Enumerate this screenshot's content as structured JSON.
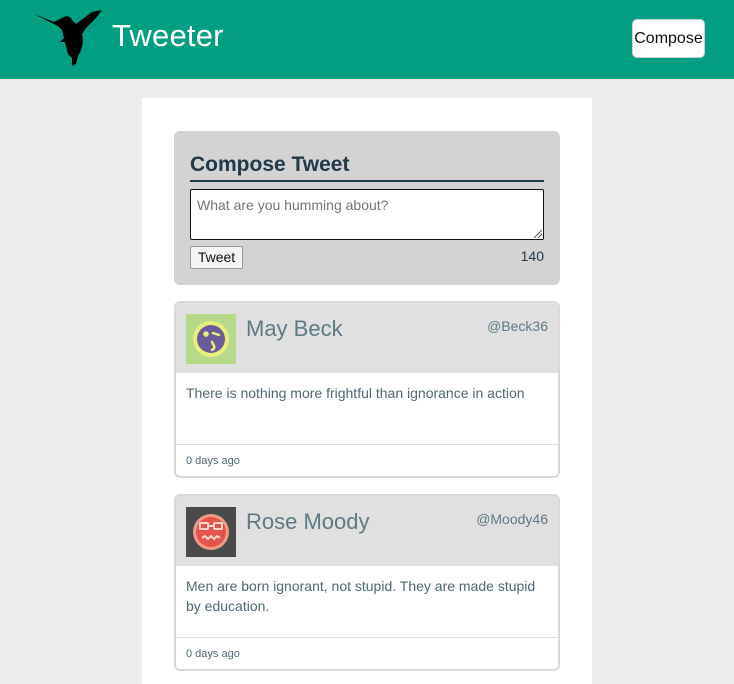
{
  "nav": {
    "brand": "Tweeter",
    "logo_icon": "hummingbird-icon",
    "compose_label": "Compose",
    "color": "#019e82"
  },
  "compose": {
    "title": "Compose Tweet",
    "placeholder": "What are you humming about?",
    "value": "",
    "tweet_label": "Tweet",
    "counter": "140"
  },
  "tweets": [
    {
      "name": "May Beck",
      "handle": "@Beck36",
      "text": "There is nothing more frightful than ignorance in action",
      "time": "0 days ago",
      "avatar_icon": "winking-face-avatar"
    },
    {
      "name": "Rose Moody",
      "handle": "@Moody46",
      "text": "Men are born ignorant, not stupid. They are made stupid by education.",
      "time": "0 days ago",
      "avatar_icon": "grimacing-face-avatar"
    }
  ]
}
